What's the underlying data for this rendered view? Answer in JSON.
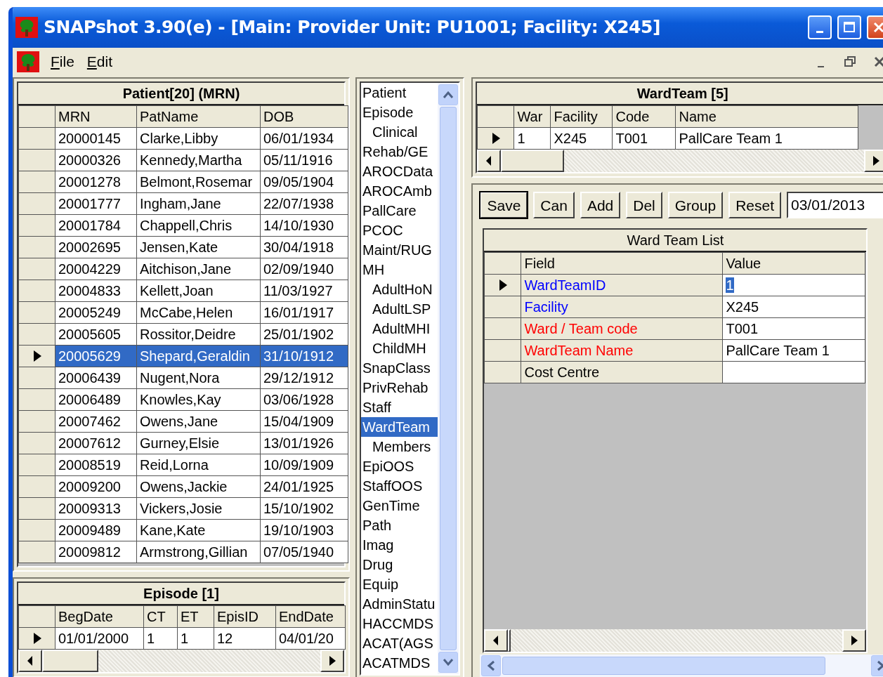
{
  "window": {
    "title": "SNAPshot 3.90(e) - [Main: Provider Unit: PU1001; Facility: X245]"
  },
  "menu": [
    {
      "label": "File"
    },
    {
      "label": "Edit"
    }
  ],
  "patient_grid": {
    "title": "Patient[20] (MRN)",
    "columns": [
      "MRN",
      "PatName",
      "DOB"
    ],
    "rows": [
      {
        "mrn": "20000145",
        "name": "Clarke,Libby",
        "dob": "06/01/1934",
        "selected": false
      },
      {
        "mrn": "20000326",
        "name": "Kennedy,Martha",
        "dob": "05/11/1916",
        "selected": false
      },
      {
        "mrn": "20001278",
        "name": "Belmont,Rosemar",
        "dob": "09/05/1904",
        "selected": false
      },
      {
        "mrn": "20001777",
        "name": "Ingham,Jane",
        "dob": "22/07/1938",
        "selected": false
      },
      {
        "mrn": "20001784",
        "name": "Chappell,Chris",
        "dob": "14/10/1930",
        "selected": false
      },
      {
        "mrn": "20002695",
        "name": "Jensen,Kate",
        "dob": "30/04/1918",
        "selected": false
      },
      {
        "mrn": "20004229",
        "name": "Aitchison,Jane",
        "dob": "02/09/1940",
        "selected": false
      },
      {
        "mrn": "20004833",
        "name": "Kellett,Joan",
        "dob": "11/03/1927",
        "selected": false
      },
      {
        "mrn": "20005249",
        "name": "McCabe,Helen",
        "dob": "16/01/1917",
        "selected": false
      },
      {
        "mrn": "20005605",
        "name": "Rossitor,Deidre",
        "dob": "25/01/1902",
        "selected": false
      },
      {
        "mrn": "20005629",
        "name": "Shepard,Geraldin",
        "dob": "31/10/1912",
        "selected": true
      },
      {
        "mrn": "20006439",
        "name": "Nugent,Nora",
        "dob": "29/12/1912",
        "selected": false
      },
      {
        "mrn": "20006489",
        "name": "Knowles,Kay",
        "dob": "03/06/1928",
        "selected": false
      },
      {
        "mrn": "20007462",
        "name": "Owens,Jane",
        "dob": "15/04/1909",
        "selected": false
      },
      {
        "mrn": "20007612",
        "name": "Gurney,Elsie",
        "dob": "13/01/1926",
        "selected": false
      },
      {
        "mrn": "20008519",
        "name": "Reid,Lorna",
        "dob": "10/09/1909",
        "selected": false
      },
      {
        "mrn": "20009200",
        "name": "Owens,Jackie",
        "dob": "24/01/1925",
        "selected": false
      },
      {
        "mrn": "20009313",
        "name": "Vickers,Josie",
        "dob": "15/10/1902",
        "selected": false
      },
      {
        "mrn": "20009489",
        "name": "Kane,Kate",
        "dob": "19/10/1903",
        "selected": false
      },
      {
        "mrn": "20009812",
        "name": "Armstrong,Gillian",
        "dob": "07/05/1940",
        "selected": false
      }
    ]
  },
  "episode_grid": {
    "title": "Episode [1]",
    "columns": [
      "BegDate",
      "CT",
      "ET",
      "EpisID",
      "EndDate"
    ],
    "rows": [
      {
        "cells": [
          "01/01/2000",
          "1",
          "1",
          "12",
          "04/01/20"
        ],
        "selected": true
      }
    ]
  },
  "nav_list": {
    "items": [
      {
        "label": "Patient",
        "selected": false
      },
      {
        "label": "Episode",
        "selected": false,
        "children": [
          {
            "label": "Clinical",
            "selected": false
          }
        ]
      },
      {
        "label": "Rehab/GE",
        "selected": false
      },
      {
        "label": "AROCData",
        "selected": false
      },
      {
        "label": "AROCAmb",
        "selected": false
      },
      {
        "label": "PallCare",
        "selected": false
      },
      {
        "label": "PCOC",
        "selected": false
      },
      {
        "label": "Maint/RUG",
        "selected": false
      },
      {
        "label": "MH",
        "selected": false,
        "children": [
          {
            "label": "AdultHoN",
            "selected": false
          },
          {
            "label": "AdultLSP",
            "selected": false
          },
          {
            "label": "AdultMHI",
            "selected": false
          },
          {
            "label": "ChildMH",
            "selected": false
          }
        ]
      },
      {
        "label": "SnapClass",
        "selected": false
      },
      {
        "label": "PrivRehab",
        "selected": false
      },
      {
        "label": "Staff",
        "selected": false
      },
      {
        "label": "WardTeam",
        "selected": true,
        "children": [
          {
            "label": "Members",
            "selected": false
          }
        ]
      },
      {
        "label": "EpiOOS",
        "selected": false
      },
      {
        "label": "StaffOOS",
        "selected": false
      },
      {
        "label": "GenTime",
        "selected": false
      },
      {
        "label": "Path",
        "selected": false
      },
      {
        "label": "Imag",
        "selected": false
      },
      {
        "label": "Drug",
        "selected": false
      },
      {
        "label": "Equip",
        "selected": false
      },
      {
        "label": "AdminStatu",
        "selected": false
      },
      {
        "label": "HACCMDS",
        "selected": false
      },
      {
        "label": "ACAT(AGS",
        "selected": false
      },
      {
        "label": "ACATMDS",
        "selected": false
      }
    ]
  },
  "wardteam_grid": {
    "title": "WardTeam [5]",
    "columns": [
      "War",
      "Facility",
      "Code",
      "Name"
    ],
    "rows": [
      {
        "cells": [
          "1",
          "X245",
          "T001",
          "PallCare Team 1"
        ],
        "selected": true
      }
    ]
  },
  "toolbar": {
    "buttons": [
      {
        "label": "Save",
        "default": true
      },
      {
        "label": "Can",
        "default": false
      },
      {
        "label": "Add",
        "default": false
      },
      {
        "label": "Del",
        "default": false
      },
      {
        "label": "Group",
        "default": false
      },
      {
        "label": "Reset",
        "default": false
      }
    ],
    "date": "03/01/2013"
  },
  "ward_team_list": {
    "title": "Ward Team List",
    "columns": [
      "Field",
      "Value"
    ],
    "rows": [
      {
        "field": "WardTeamID",
        "value": "1",
        "color": "#0000ff",
        "selected": true
      },
      {
        "field": "Facility",
        "value": "X245",
        "color": "#0000ff",
        "selected": false
      },
      {
        "field": "Ward / Team code",
        "value": "T001",
        "color": "#ff0000",
        "selected": false
      },
      {
        "field": "WardTeam Name",
        "value": "PallCare Team 1",
        "color": "#ff0000",
        "selected": false
      },
      {
        "field": "Cost Centre",
        "value": "",
        "color": "#000000",
        "selected": false
      }
    ]
  }
}
